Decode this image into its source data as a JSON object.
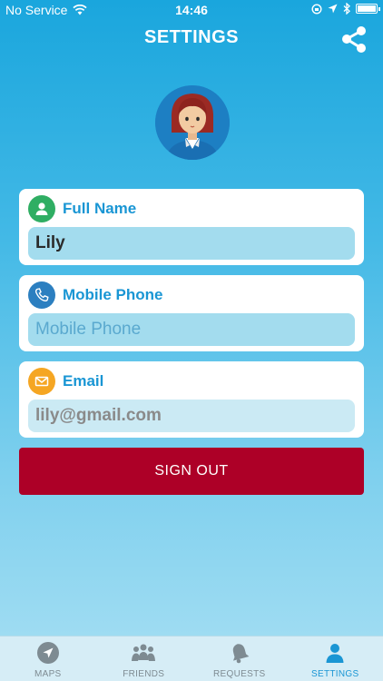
{
  "status_bar": {
    "carrier": "No Service",
    "time": "14:46"
  },
  "header": {
    "title": "SETTINGS",
    "share_icon": "share-icon"
  },
  "avatar": {
    "icon": "user-avatar"
  },
  "fields": {
    "name": {
      "label": "Full Name",
      "value": "Lily",
      "icon": "person-icon",
      "icon_color": "#2fae63"
    },
    "phone": {
      "label": "Mobile Phone",
      "value": "",
      "placeholder": "Mobile Phone",
      "icon": "phone-icon",
      "icon_color": "#2c7fc0"
    },
    "email": {
      "label": "Email",
      "value": "lily@gmail.com",
      "icon": "mail-icon",
      "icon_color": "#f5a623"
    }
  },
  "sign_out": {
    "label": "SIGN OUT",
    "color": "#ad0027"
  },
  "tabs": [
    {
      "label": "MAPS",
      "icon": "navigation-arrow-icon",
      "active": false
    },
    {
      "label": "FRIENDS",
      "icon": "group-icon",
      "active": false
    },
    {
      "label": "REQUESTS",
      "icon": "bell-icon",
      "active": false
    },
    {
      "label": "SETTINGS",
      "icon": "person-icon",
      "active": true
    }
  ],
  "colors": {
    "accent": "#1a96d4",
    "background_top": "#1aa6dd",
    "background_bottom": "#a7dff3"
  }
}
